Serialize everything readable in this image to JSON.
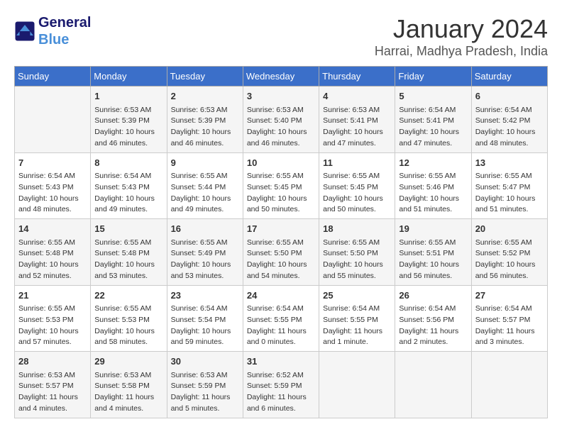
{
  "header": {
    "logo_line1": "General",
    "logo_line2": "Blue",
    "title": "January 2024",
    "subtitle": "Harrai, Madhya Pradesh, India"
  },
  "days_of_week": [
    "Sunday",
    "Monday",
    "Tuesday",
    "Wednesday",
    "Thursday",
    "Friday",
    "Saturday"
  ],
  "weeks": [
    [
      {
        "day": "",
        "info": ""
      },
      {
        "day": "1",
        "info": "Sunrise: 6:53 AM\nSunset: 5:39 PM\nDaylight: 10 hours\nand 46 minutes."
      },
      {
        "day": "2",
        "info": "Sunrise: 6:53 AM\nSunset: 5:39 PM\nDaylight: 10 hours\nand 46 minutes."
      },
      {
        "day": "3",
        "info": "Sunrise: 6:53 AM\nSunset: 5:40 PM\nDaylight: 10 hours\nand 46 minutes."
      },
      {
        "day": "4",
        "info": "Sunrise: 6:53 AM\nSunset: 5:41 PM\nDaylight: 10 hours\nand 47 minutes."
      },
      {
        "day": "5",
        "info": "Sunrise: 6:54 AM\nSunset: 5:41 PM\nDaylight: 10 hours\nand 47 minutes."
      },
      {
        "day": "6",
        "info": "Sunrise: 6:54 AM\nSunset: 5:42 PM\nDaylight: 10 hours\nand 48 minutes."
      }
    ],
    [
      {
        "day": "7",
        "info": "Sunrise: 6:54 AM\nSunset: 5:43 PM\nDaylight: 10 hours\nand 48 minutes."
      },
      {
        "day": "8",
        "info": "Sunrise: 6:54 AM\nSunset: 5:43 PM\nDaylight: 10 hours\nand 49 minutes."
      },
      {
        "day": "9",
        "info": "Sunrise: 6:55 AM\nSunset: 5:44 PM\nDaylight: 10 hours\nand 49 minutes."
      },
      {
        "day": "10",
        "info": "Sunrise: 6:55 AM\nSunset: 5:45 PM\nDaylight: 10 hours\nand 50 minutes."
      },
      {
        "day": "11",
        "info": "Sunrise: 6:55 AM\nSunset: 5:45 PM\nDaylight: 10 hours\nand 50 minutes."
      },
      {
        "day": "12",
        "info": "Sunrise: 6:55 AM\nSunset: 5:46 PM\nDaylight: 10 hours\nand 51 minutes."
      },
      {
        "day": "13",
        "info": "Sunrise: 6:55 AM\nSunset: 5:47 PM\nDaylight: 10 hours\nand 51 minutes."
      }
    ],
    [
      {
        "day": "14",
        "info": "Sunrise: 6:55 AM\nSunset: 5:48 PM\nDaylight: 10 hours\nand 52 minutes."
      },
      {
        "day": "15",
        "info": "Sunrise: 6:55 AM\nSunset: 5:48 PM\nDaylight: 10 hours\nand 53 minutes."
      },
      {
        "day": "16",
        "info": "Sunrise: 6:55 AM\nSunset: 5:49 PM\nDaylight: 10 hours\nand 53 minutes."
      },
      {
        "day": "17",
        "info": "Sunrise: 6:55 AM\nSunset: 5:50 PM\nDaylight: 10 hours\nand 54 minutes."
      },
      {
        "day": "18",
        "info": "Sunrise: 6:55 AM\nSunset: 5:50 PM\nDaylight: 10 hours\nand 55 minutes."
      },
      {
        "day": "19",
        "info": "Sunrise: 6:55 AM\nSunset: 5:51 PM\nDaylight: 10 hours\nand 56 minutes."
      },
      {
        "day": "20",
        "info": "Sunrise: 6:55 AM\nSunset: 5:52 PM\nDaylight: 10 hours\nand 56 minutes."
      }
    ],
    [
      {
        "day": "21",
        "info": "Sunrise: 6:55 AM\nSunset: 5:53 PM\nDaylight: 10 hours\nand 57 minutes."
      },
      {
        "day": "22",
        "info": "Sunrise: 6:55 AM\nSunset: 5:53 PM\nDaylight: 10 hours\nand 58 minutes."
      },
      {
        "day": "23",
        "info": "Sunrise: 6:54 AM\nSunset: 5:54 PM\nDaylight: 10 hours\nand 59 minutes."
      },
      {
        "day": "24",
        "info": "Sunrise: 6:54 AM\nSunset: 5:55 PM\nDaylight: 11 hours\nand 0 minutes."
      },
      {
        "day": "25",
        "info": "Sunrise: 6:54 AM\nSunset: 5:55 PM\nDaylight: 11 hours\nand 1 minute."
      },
      {
        "day": "26",
        "info": "Sunrise: 6:54 AM\nSunset: 5:56 PM\nDaylight: 11 hours\nand 2 minutes."
      },
      {
        "day": "27",
        "info": "Sunrise: 6:54 AM\nSunset: 5:57 PM\nDaylight: 11 hours\nand 3 minutes."
      }
    ],
    [
      {
        "day": "28",
        "info": "Sunrise: 6:53 AM\nSunset: 5:57 PM\nDaylight: 11 hours\nand 4 minutes."
      },
      {
        "day": "29",
        "info": "Sunrise: 6:53 AM\nSunset: 5:58 PM\nDaylight: 11 hours\nand 4 minutes."
      },
      {
        "day": "30",
        "info": "Sunrise: 6:53 AM\nSunset: 5:59 PM\nDaylight: 11 hours\nand 5 minutes."
      },
      {
        "day": "31",
        "info": "Sunrise: 6:52 AM\nSunset: 5:59 PM\nDaylight: 11 hours\nand 6 minutes."
      },
      {
        "day": "",
        "info": ""
      },
      {
        "day": "",
        "info": ""
      },
      {
        "day": "",
        "info": ""
      }
    ]
  ]
}
